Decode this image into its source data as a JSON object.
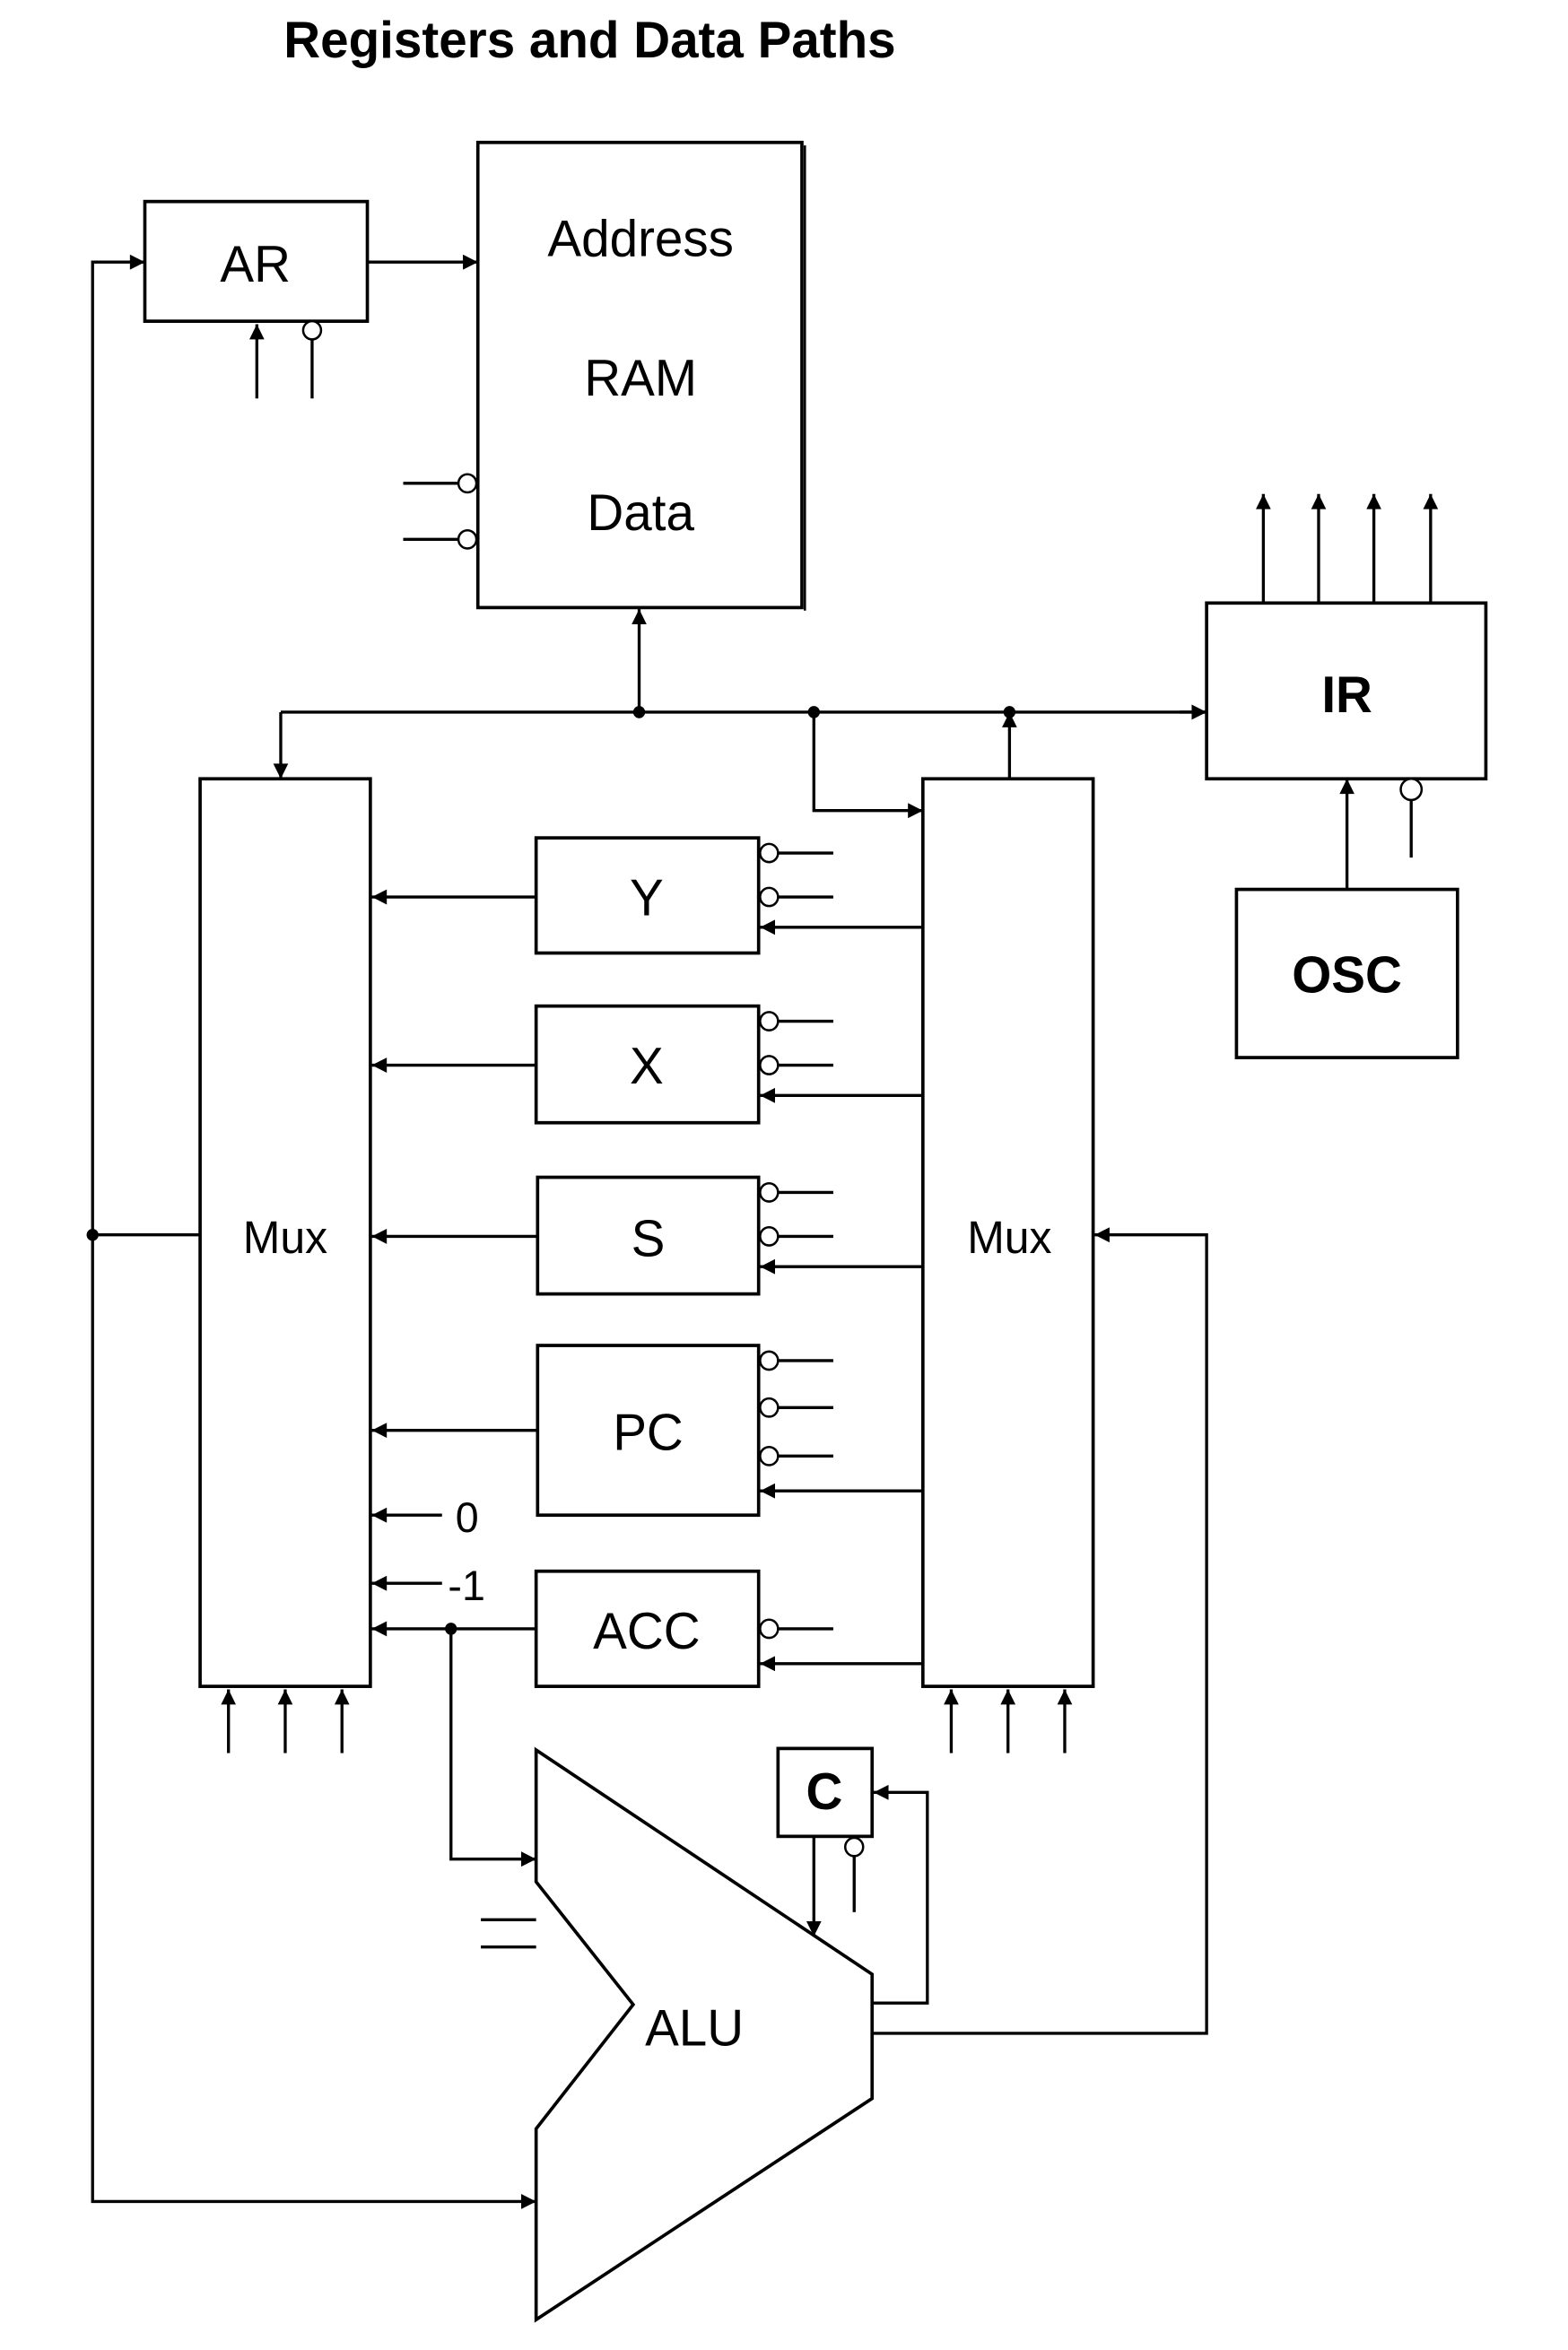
{
  "title": "Registers and Data Paths",
  "blocks": {
    "ar": "AR",
    "ram_address": "Address",
    "ram_label": "RAM",
    "ram_data": "Data",
    "ir": "IR",
    "osc": "OSC",
    "mux_left": "Mux",
    "mux_right": "Mux",
    "y": "Y",
    "x": "X",
    "s": "S",
    "pc": "PC",
    "acc": "ACC",
    "c": "C",
    "alu": "ALU"
  },
  "constants": {
    "zero": "0",
    "minus_one": "-1"
  },
  "colors": {
    "stroke": "#000000",
    "background": "#ffffff"
  }
}
